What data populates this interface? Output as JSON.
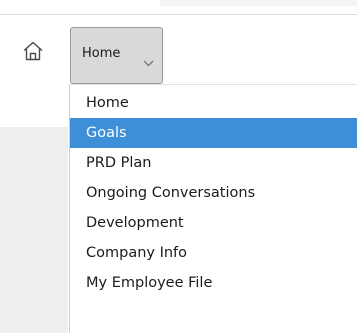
{
  "nav": {
    "home_icon": "home-icon",
    "button_label": "Home",
    "chevron_icon": "chevron-down-icon"
  },
  "menu": {
    "selected_color": "#3d8fd8",
    "items": [
      {
        "label": "Home",
        "selected": false
      },
      {
        "label": "Goals",
        "selected": true
      },
      {
        "label": "PRD Plan",
        "selected": false
      },
      {
        "label": "Ongoing Conversations",
        "selected": false
      },
      {
        "label": "Development",
        "selected": false
      },
      {
        "label": "Company Info",
        "selected": false
      },
      {
        "label": "My Employee File",
        "selected": false
      }
    ]
  }
}
